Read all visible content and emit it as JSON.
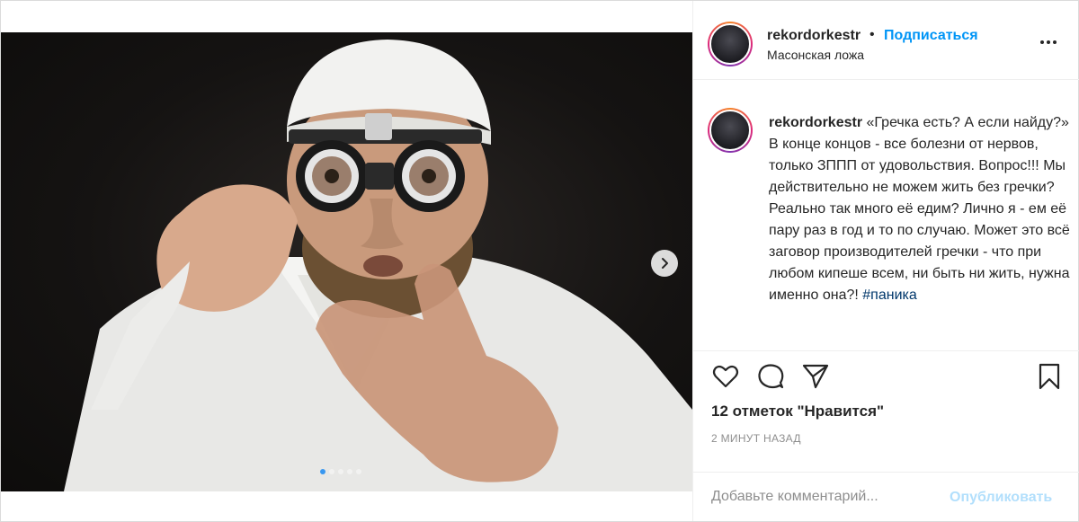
{
  "post": {
    "username": "rekordorkestr",
    "bullet": "•",
    "follow_label": "Подписаться",
    "location": "Масонская ложа",
    "caption": {
      "username": "rekordorkestr",
      "text": "«Гречка есть? А если найду?» В конце концов - все болезни от нервов, только ЗППП от удовольствия. Вопрос!!! Мы действительно не можем жить без гречки? Реально так много её едим? Лично я - ем её пару раз в год и то по случаю. Может это всё заговор производителей гречки - что при любом кипеше всем, ни быть ни жить, нужна именно она?!",
      "hashtag": "#паника"
    },
    "likes": "12 отметок \"Нравится\"",
    "time": "2 МИНУТ НАЗАД",
    "comment_placeholder": "Добавьте комментарий...",
    "publish_label": "Опубликовать"
  },
  "carousel": {
    "slide_count": 5,
    "current_slide": 1
  },
  "icons": [
    "more-options-icon",
    "heart-icon",
    "comment-icon",
    "share-icon",
    "bookmark-icon",
    "chevron-right-icon"
  ],
  "colors": {
    "accent": "#0095f6",
    "hashtag": "#00376b",
    "publish_disabled": "#b2dffc",
    "muted": "#8e8e8e",
    "dot_active": "#3897f0"
  }
}
